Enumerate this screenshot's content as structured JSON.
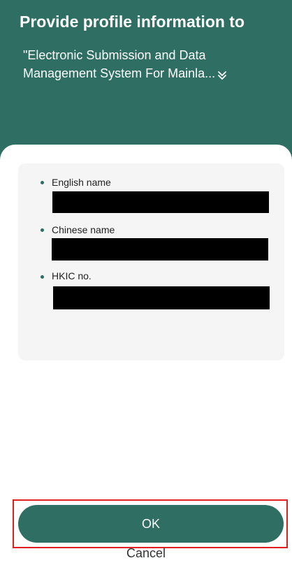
{
  "header": {
    "title": "Provide profile information to",
    "subtitle_line1": "\"Electronic Submission and Data",
    "subtitle_line2": "Management System For Mainla...",
    "expand_icon": "chevron-double-down-icon"
  },
  "profile_fields": [
    {
      "label": "English name",
      "value_redacted": true
    },
    {
      "label": "Chinese name",
      "value_redacted": true
    },
    {
      "label": "HKIC no.",
      "value_redacted": true
    }
  ],
  "actions": {
    "ok_label": "OK",
    "cancel_label": "Cancel"
  },
  "colors": {
    "brand": "#2f6e63",
    "card_bg": "#f4f5f4",
    "highlight": "#e02020",
    "redaction": "#000000"
  }
}
